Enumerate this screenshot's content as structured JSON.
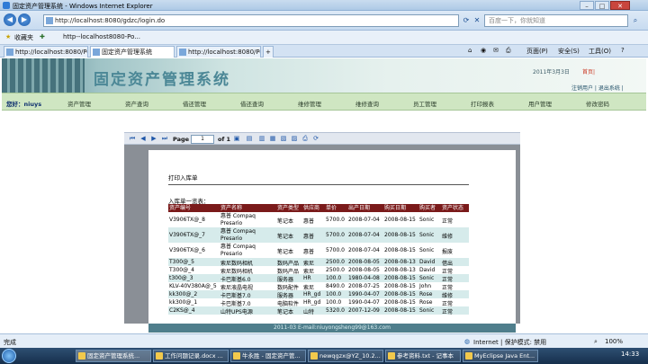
{
  "window": {
    "title": "固定资产管理系统 - Windows Internet Explorer"
  },
  "browser": {
    "url": "http://localhost:8080/gdzc/login.do",
    "search_placeholder": "百度一下，你就知道",
    "favorites_label": "收藏夹",
    "fav_link": "http--localhost8080-Po...",
    "tabs": [
      {
        "label": "http://localhost:8080/Po..."
      },
      {
        "label": "固定资产管理系统"
      },
      {
        "label": "http://localhost:8080/Po..."
      }
    ],
    "tools": {
      "page": "页面(P)",
      "safety": "安全(S)",
      "tools": "工具(O)",
      "help": "?"
    }
  },
  "app": {
    "system_title": "固定资产管理系统",
    "date": "2011年3月3日",
    "home": "首页|",
    "top_links": "注销用户 | 退出系统 |",
    "user_label": "您好：niuys",
    "menu": [
      "资产管理",
      "资产查询",
      "借还管理",
      "借还查询",
      "维修管理",
      "维修查询",
      "员工管理",
      "打印报表",
      "用户管理",
      "修改密码"
    ]
  },
  "pdf": {
    "page_label": "Page",
    "page_value": "1",
    "of_label": "of 1"
  },
  "document": {
    "title": "打印入库单",
    "list_label": "入库单一览表：",
    "columns": [
      "资产编号",
      "资产名称",
      "资产类型",
      "供应商",
      "单价",
      "出产日期",
      "购买日期",
      "购买者",
      "资产状态"
    ],
    "rows": [
      [
        "V3906TX@_8",
        "惠普 Compaq Presario",
        "笔记本",
        "惠普",
        "5700.0",
        "2008-07-04",
        "2008-08-15",
        "Sonic",
        "正常"
      ],
      [
        "V3906TX@_7",
        "惠普 Compaq Presario",
        "笔记本",
        "惠普",
        "5700.0",
        "2008-07-04",
        "2008-08-15",
        "Sonic",
        "维修"
      ],
      [
        "V3906TX@_6",
        "惠普 Compaq Presario",
        "笔记本",
        "惠普",
        "5700.0",
        "2008-07-04",
        "2008-08-15",
        "Sonic",
        "报废"
      ],
      [
        "T300@_5",
        "索尼数码相机",
        "数码产品",
        "索尼",
        "2500.0",
        "2008-08-05",
        "2008-08-13",
        "David",
        "借出"
      ],
      [
        "T300@_4",
        "索尼数码相机",
        "数码产品",
        "索尼",
        "2500.0",
        "2008-08-05",
        "2008-08-13",
        "David",
        "正常"
      ],
      [
        "t300@_3",
        "卡巴斯基6.0",
        "服务器",
        "HR",
        "100.0",
        "1980-04-08",
        "2008-08-15",
        "Sonic",
        "正常"
      ],
      [
        "KLV-40V380A@_5",
        "索尼液晶电视",
        "数码配件",
        "索尼",
        "8490.0",
        "2008-07-25",
        "2008-08-15",
        "John",
        "正常"
      ],
      [
        "kk300@_2",
        "卡巴斯基7.0",
        "服务器",
        "HR_gd",
        "100.0",
        "1990-04-07",
        "2008-08-15",
        "Rose",
        "维修"
      ],
      [
        "kk300@_1",
        "卡巴斯基7.0",
        "电脑软件",
        "HR_gd",
        "100.0",
        "1990-04-07",
        "2008-08-15",
        "Rose",
        "正常"
      ],
      [
        "C2KS@_4",
        "山特UPS电源",
        "笔记本",
        "山特",
        "5320.0",
        "2007-12-09",
        "2008-08-15",
        "Sonic",
        "正常"
      ]
    ],
    "footer": "2011-03 E-mail:niuyongsheng99@163.com"
  },
  "statusbar": {
    "left": "完成",
    "zone": "Internet | 保护模式: 禁用",
    "zoom": "100%"
  },
  "taskbar": {
    "items": [
      "固定资产管理系统...",
      "工作问题记录.docx ...",
      "牛永胜 - 固定资产管...",
      "newqgzx@YZ_10.2...",
      "参考资料.txt - 记事本",
      "MyEclipse Java Ent..."
    ],
    "clock": "14:33"
  }
}
